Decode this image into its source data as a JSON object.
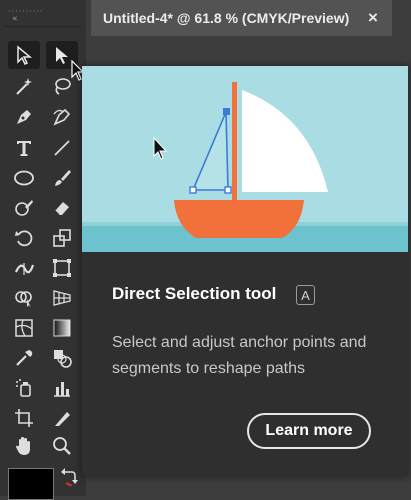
{
  "document_tab": {
    "title": "Untitled-4* @ 61.8 % (CMYK/Preview)",
    "close_glyph": "×"
  },
  "toolbar": {
    "collapse_glyph": "«",
    "tools": [
      "direct-selection-tool",
      "selection-tool",
      "magic-wand-tool",
      "lasso-tool",
      "pen-tool",
      "curvature-tool",
      "type-tool",
      "line-segment-tool",
      "ellipse-tool",
      "paintbrush-tool",
      "shaper-tool",
      "eraser-tool",
      "rotate-tool",
      "scale-tool",
      "width-tool",
      "free-transform-tool",
      "shape-builder-tool",
      "perspective-grid-tool",
      "mesh-tool",
      "gradient-tool",
      "eyedropper-tool",
      "blend-tool",
      "symbol-sprayer-tool",
      "column-graph-tool",
      "artboard-tool",
      "slice-tool",
      "hand-tool",
      "zoom-tool"
    ],
    "fill_color": "#000000"
  },
  "tooltip": {
    "title": "Direct Selection tool",
    "shortcut": "A",
    "description": "Select and adjust anchor points and segments to reshape paths",
    "learn_more_label": "Learn more",
    "illustration": "sailboat-on-water"
  },
  "colors": {
    "sky": "#a9dde3",
    "water": "#6cc3cd",
    "hull": "#f2703a",
    "mast": "#f2703a",
    "sail": "#ffffff",
    "selection": "#3d7ad6",
    "panel": "#2f2f2f",
    "toolbar": "#323232"
  }
}
